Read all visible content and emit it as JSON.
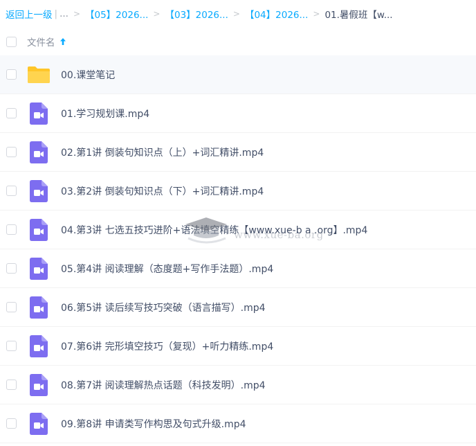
{
  "breadcrumb": {
    "back_label": "返回上一级",
    "separator_bar": "|",
    "ellipsis": "...",
    "arrow": ">",
    "items": [
      "【05】2026...",
      "【03】2026...",
      "【04】2026..."
    ],
    "current": "01.暑假班【w..."
  },
  "header": {
    "column_label": "文件名",
    "sort_direction": "ascending"
  },
  "files": [
    {
      "name": "00.课堂笔记",
      "type": "folder",
      "icon": "folder-icon"
    },
    {
      "name": "01.学习规划课.mp4",
      "type": "video",
      "icon": "video-file-icon"
    },
    {
      "name": "02.第1讲 倒装句知识点（上）+词汇精讲.mp4",
      "type": "video",
      "icon": "video-file-icon"
    },
    {
      "name": "03.第2讲 倒装句知识点（下）+词汇精讲.mp4",
      "type": "video",
      "icon": "video-file-icon"
    },
    {
      "name": "04.第3讲 七选五技巧进阶+语法填空精练【www.xue-b a .org】.mp4",
      "type": "video",
      "icon": "video-file-icon"
    },
    {
      "name": "05.第4讲 阅读理解（态度题+写作手法题）.mp4",
      "type": "video",
      "icon": "video-file-icon"
    },
    {
      "name": "06.第5讲 读后续写技巧突破（语言描写）.mp4",
      "type": "video",
      "icon": "video-file-icon"
    },
    {
      "name": "07.第6讲 完形填空技巧（复现）+听力精练.mp4",
      "type": "video",
      "icon": "video-file-icon"
    },
    {
      "name": "08.第7讲 阅读理解热点话题（科技发明）.mp4",
      "type": "video",
      "icon": "video-file-icon"
    },
    {
      "name": "09.第8讲 申请类写作构思及句式升级.mp4",
      "type": "video",
      "icon": "video-file-icon"
    }
  ],
  "watermark": {
    "text": "www.xue-ba.org"
  },
  "colors": {
    "link": "#09aaff",
    "folder": "#ffd155",
    "video": "#7d6df0",
    "text": "#424e67",
    "muted": "#8a919f"
  }
}
